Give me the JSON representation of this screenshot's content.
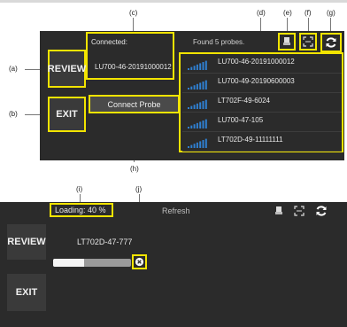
{
  "callouts": {
    "a": "(a)",
    "b": "(b)",
    "c": "(c)",
    "d": "(d)",
    "e": "(e)",
    "f": "(f)",
    "g": "(g)",
    "h": "(h)",
    "i": "(i)",
    "j": "(j)"
  },
  "panel_top": {
    "connected_label": "Connected:",
    "connected_probe": "LU700-46-20191000012",
    "found_text": "Found 5 probes.",
    "review_label": "REVIEW",
    "exit_label": "EXIT",
    "connect_button_label": "Connect Probe",
    "probes": [
      {
        "name": "LU700-46-20191000012"
      },
      {
        "name": "LU700-49-20190600003"
      },
      {
        "name": "LT702F-49-6024"
      },
      {
        "name": "LU700-47-105"
      },
      {
        "name": "LT702D-49-11111111"
      }
    ]
  },
  "panel_bottom": {
    "loading_text": "Loading: 40 %",
    "loading_progress": 0.4,
    "refresh_label": "Refresh",
    "review_label": "REVIEW",
    "exit_label": "EXIT",
    "probe_name": "LT702D-47-777"
  },
  "colors": {
    "panel_bg": "#2b2b2b",
    "highlight": "#f2e400",
    "text": "#e8e8e8",
    "signal": "#2f7fd0"
  },
  "icons": {
    "probe": "probe-icon",
    "scan": "scan-icon",
    "refresh": "refresh-icon",
    "cancel": "cancel-icon",
    "signal": "signal-strength-icon"
  }
}
